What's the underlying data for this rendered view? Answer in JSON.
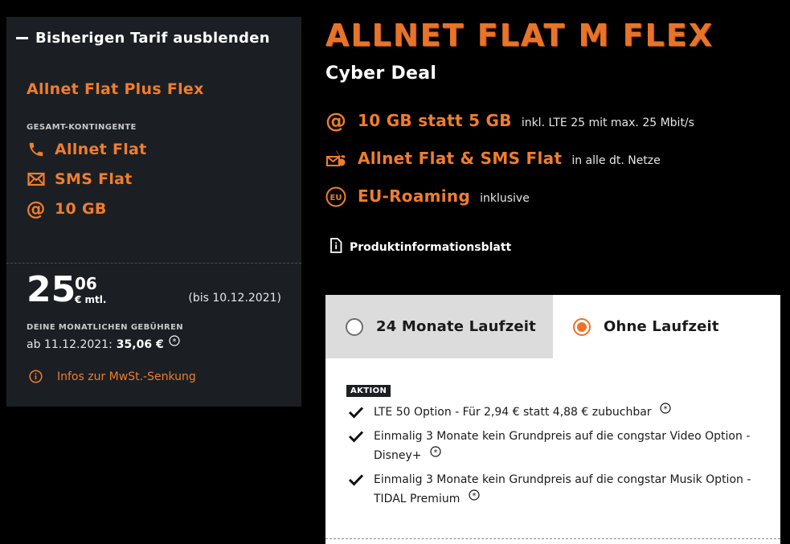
{
  "left": {
    "toggle_label": "Bisherigen Tarif ausblenden",
    "prev_tariff_name": "Allnet Flat Plus Flex",
    "quota_heading": "GESAMT-KONTINGENTE",
    "quota_items": [
      {
        "icon": "phone-icon",
        "label": "Allnet Flat"
      },
      {
        "icon": "envelope-icon",
        "label": "SMS Flat"
      },
      {
        "icon": "at-icon",
        "label": "10 GB"
      }
    ],
    "price_euros": "25",
    "price_cents": "06",
    "price_unit": "€ mtl.",
    "price_until": "(bis 10.12.2021)",
    "fees_heading": "DEINE MONATLICHEN GEBÜHREN",
    "fees_from": "ab 11.12.2021:",
    "fees_amount": "35,06 €",
    "mwst_link": "Infos zur MwSt.-Senkung"
  },
  "right": {
    "title": "ALLNET FLAT M FLEX",
    "subtitle": "Cyber Deal",
    "features": [
      {
        "icon": "at-icon",
        "main": "10 GB statt 5 GB",
        "sub": "inkl. LTE 25 mit max. 25 Mbit/s"
      },
      {
        "icon": "phone-sms-icon",
        "main": "Allnet Flat & SMS Flat",
        "sub": "in alle dt. Netze"
      },
      {
        "icon": "eu-icon",
        "main": "EU-Roaming",
        "sub": "inklusive"
      }
    ],
    "product_info": "Produktinformationsblatt"
  },
  "contract": {
    "tabs": [
      {
        "label": "24 Monate Laufzeit",
        "selected": false
      },
      {
        "label": "Ohne Laufzeit",
        "selected": true
      }
    ],
    "badge": "AKTION",
    "promos": [
      "LTE 50 Option - Für 2,94 € statt 4,88 € zubuchbar",
      "Einmalig 3 Monate kein Grundpreis auf die congstar Video Option - Disney+",
      "Einmalig 3 Monate kein Grundpreis auf die congstar Musik Option - TIDAL Premium"
    ]
  },
  "colors": {
    "accent": "#f07d2d",
    "card_bg": "#1b1f24",
    "page_bg": "#000000"
  }
}
